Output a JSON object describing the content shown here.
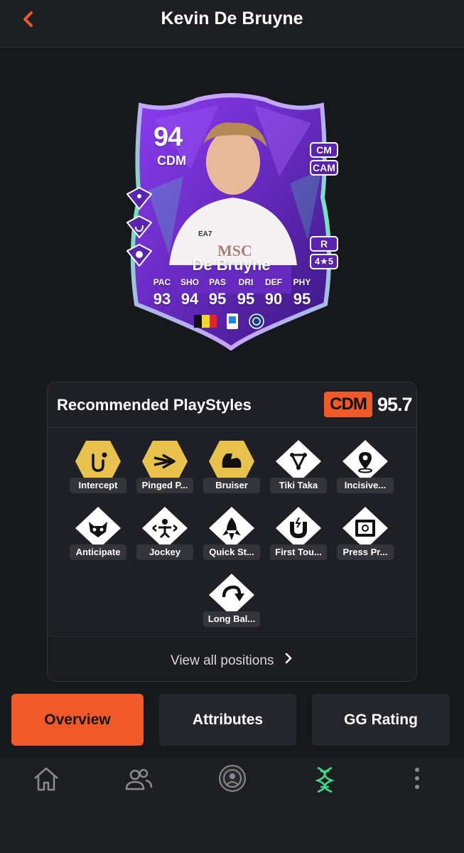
{
  "header": {
    "title": "Kevin De Bruyne"
  },
  "card": {
    "rating": "94",
    "position": "CDM",
    "alt_positions": [
      "CM",
      "CAM"
    ],
    "foot": "R",
    "skills_weakfoot": "4★5",
    "name": "De Bruyne",
    "stats": [
      {
        "label": "PAC",
        "value": "93"
      },
      {
        "label": "SHO",
        "value": "94"
      },
      {
        "label": "PAS",
        "value": "95"
      },
      {
        "label": "DRI",
        "value": "95"
      },
      {
        "label": "DEF",
        "value": "90"
      },
      {
        "label": "PHY",
        "value": "95"
      }
    ],
    "shirt_text": "MSC",
    "shirt_brand": "EA7"
  },
  "playstyles": {
    "title": "Recommended PlayStyles",
    "position": "CDM",
    "score": "95.7",
    "items": [
      {
        "label": "Intercept",
        "icon": "intercept-icon",
        "plus": true
      },
      {
        "label": "Pinged P...",
        "icon": "pinged-pass-icon",
        "plus": true
      },
      {
        "label": "Bruiser",
        "icon": "bruiser-icon",
        "plus": true
      },
      {
        "label": "Tiki Taka",
        "icon": "tiki-taka-icon",
        "plus": false
      },
      {
        "label": "Incisive...",
        "icon": "incisive-pass-icon",
        "plus": false
      },
      {
        "label": "Anticipate",
        "icon": "anticipate-icon",
        "plus": false
      },
      {
        "label": "Jockey",
        "icon": "jockey-icon",
        "plus": false
      },
      {
        "label": "Quick St...",
        "icon": "quick-step-icon",
        "plus": false
      },
      {
        "label": "First Tou...",
        "icon": "first-touch-icon",
        "plus": false
      },
      {
        "label": "Press Pr...",
        "icon": "press-proven-icon",
        "plus": false
      },
      {
        "label": "Long Bal...",
        "icon": "long-ball-pass-icon",
        "plus": false
      }
    ],
    "view_all": "View all positions"
  },
  "tabs": {
    "overview": "Overview",
    "attributes": "Attributes",
    "gg_rating": "GG Rating"
  },
  "colors": {
    "accent": "#f05a28",
    "gold": "#e9c14d",
    "card_purple": "#6a2bc4",
    "nav_active": "#3fd68a"
  }
}
